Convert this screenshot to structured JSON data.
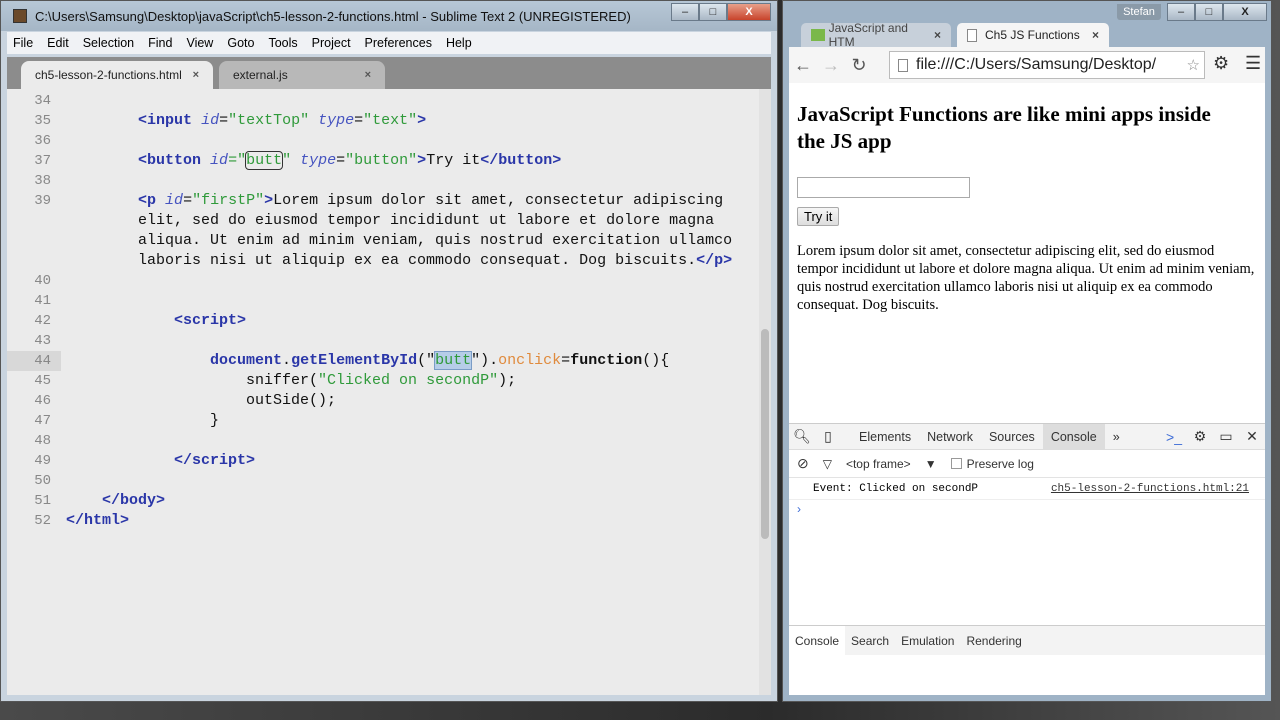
{
  "sublime": {
    "title": "C:\\Users\\Samsung\\Desktop\\javaScript\\ch5-lesson-2-functions.html - Sublime Text 2 (UNREGISTERED)",
    "menu": [
      "File",
      "Edit",
      "Selection",
      "Find",
      "View",
      "Goto",
      "Tools",
      "Project",
      "Preferences",
      "Help"
    ],
    "tabs": [
      {
        "label": "ch5-lesson-2-functions.html",
        "close": "×"
      },
      {
        "label": "external.js",
        "close": "×"
      }
    ],
    "win": {
      "min": "–",
      "max": "□",
      "close": "X"
    },
    "lines": [
      {
        "n": "34",
        "t": []
      },
      {
        "n": "35",
        "t": [
          [
            "        ",
            "pl"
          ],
          [
            "<",
            "tag"
          ],
          [
            "input",
            "tag"
          ],
          [
            " ",
            "pl"
          ],
          [
            "id",
            "attr"
          ],
          [
            "=",
            "pl"
          ],
          [
            "\"textTop\"",
            "str"
          ],
          [
            " ",
            "pl"
          ],
          [
            "type",
            "attr"
          ],
          [
            "=",
            "pl"
          ],
          [
            "\"text\"",
            "str"
          ],
          [
            ">",
            "tag"
          ]
        ]
      },
      {
        "n": "36",
        "t": []
      },
      {
        "n": "37",
        "t": [
          [
            "        ",
            "pl"
          ],
          [
            "<button",
            "tag"
          ],
          [
            " ",
            "pl"
          ],
          [
            "id",
            "attr"
          ],
          [
            "=\"",
            "str"
          ],
          [
            "butt",
            "str box"
          ],
          [
            "\"",
            "str"
          ],
          [
            " ",
            "pl"
          ],
          [
            "type",
            "attr"
          ],
          [
            "=",
            "pl"
          ],
          [
            "\"button\"",
            "str"
          ],
          [
            ">",
            "tag"
          ],
          [
            "Try it",
            "pl"
          ],
          [
            "</button>",
            "tag"
          ]
        ]
      },
      {
        "n": "38",
        "t": []
      },
      {
        "n": "39",
        "t": [
          [
            "        ",
            "pl"
          ],
          [
            "<p",
            "tag"
          ],
          [
            " ",
            "pl"
          ],
          [
            "id",
            "attr"
          ],
          [
            "=",
            "pl"
          ],
          [
            "\"firstP\"",
            "str"
          ],
          [
            ">",
            "tag"
          ],
          [
            "Lorem ipsum dolor sit amet, consectetur adipiscing",
            "pl"
          ]
        ]
      },
      {
        "n": "",
        "t": [
          [
            "        elit, sed do eiusmod tempor incididunt ut labore et dolore magna",
            "pl"
          ]
        ]
      },
      {
        "n": "",
        "t": [
          [
            "        aliqua. Ut enim ad minim veniam, quis nostrud exercitation ullamco",
            "pl"
          ]
        ]
      },
      {
        "n": "",
        "t": [
          [
            "        laboris nisi ut aliquip ex ea commodo consequat. Dog biscuits.",
            "pl"
          ],
          [
            "</p>",
            "tag"
          ]
        ]
      },
      {
        "n": "40",
        "t": []
      },
      {
        "n": "41",
        "t": []
      },
      {
        "n": "42",
        "t": [
          [
            "            ",
            "pl"
          ],
          [
            "<script>",
            "tag"
          ]
        ]
      },
      {
        "n": "43",
        "t": []
      },
      {
        "n": "44",
        "t": [
          [
            "                ",
            "pl"
          ],
          [
            "document",
            "fn"
          ],
          [
            ".",
            "pl"
          ],
          [
            "getElementById",
            "fn"
          ],
          [
            "(\"",
            "pl"
          ],
          [
            "butt",
            "str sel"
          ],
          [
            "\"",
            "pl"
          ],
          [
            ").",
            "pl"
          ],
          [
            "onclick",
            "prop"
          ],
          [
            "=",
            "pl"
          ],
          [
            "function",
            "kw"
          ],
          [
            "(){",
            "pl"
          ]
        ],
        "cur": true
      },
      {
        "n": "45",
        "t": [
          [
            "                    sniffer(",
            "pl"
          ],
          [
            "\"Clicked on secondP\"",
            "str"
          ],
          [
            ");",
            "pl"
          ]
        ]
      },
      {
        "n": "46",
        "t": [
          [
            "                    outSide();",
            "pl"
          ]
        ]
      },
      {
        "n": "47",
        "t": [
          [
            "                }",
            "pl"
          ]
        ]
      },
      {
        "n": "48",
        "t": []
      },
      {
        "n": "49",
        "t": [
          [
            "            ",
            "pl"
          ],
          [
            "</script>",
            "tag"
          ]
        ]
      },
      {
        "n": "50",
        "t": []
      },
      {
        "n": "51",
        "t": [
          [
            "    ",
            "pl"
          ],
          [
            "</body>",
            "tag"
          ]
        ]
      },
      {
        "n": "52",
        "t": [
          [
            "",
            "pl"
          ],
          [
            "</html>",
            "tag"
          ]
        ]
      }
    ]
  },
  "chrome": {
    "profile": "Stefan",
    "win": {
      "min": "–",
      "max": "□",
      "close": "X"
    },
    "tabs": [
      {
        "label": "JavaScript and HTM",
        "close": "×"
      },
      {
        "label": "Ch5 JS Functions",
        "close": "×"
      }
    ],
    "nav": {
      "back": "←",
      "forward": "→",
      "reload": "↻",
      "star": "☆",
      "settings": "⚙",
      "menu": "☰"
    },
    "url": "file:///C:/Users/Samsung/Desktop/",
    "page": {
      "heading": "JavaScript Functions are like mini apps inside the JS app",
      "button": "Try it",
      "paragraph": "Lorem ipsum dolor sit amet, consectetur adipiscing elit, sed do eiusmod tempor incididunt ut labore et dolore magna aliqua. Ut enim ad minim veniam, quis nostrud exercitation ullamco laboris nisi ut aliquip ex ea commodo consequat. Dog biscuits."
    },
    "devtools": {
      "tabs": [
        "Elements",
        "Network",
        "Sources",
        "Console"
      ],
      "more": "»",
      "frame": "<top frame>",
      "preserve": "Preserve log",
      "message": "Event: Clicked on secondP",
      "source": "ch5-lesson-2-functions.html:21",
      "prompt": "›",
      "drawer": [
        "Console",
        "Search",
        "Emulation",
        "Rendering"
      ]
    }
  }
}
